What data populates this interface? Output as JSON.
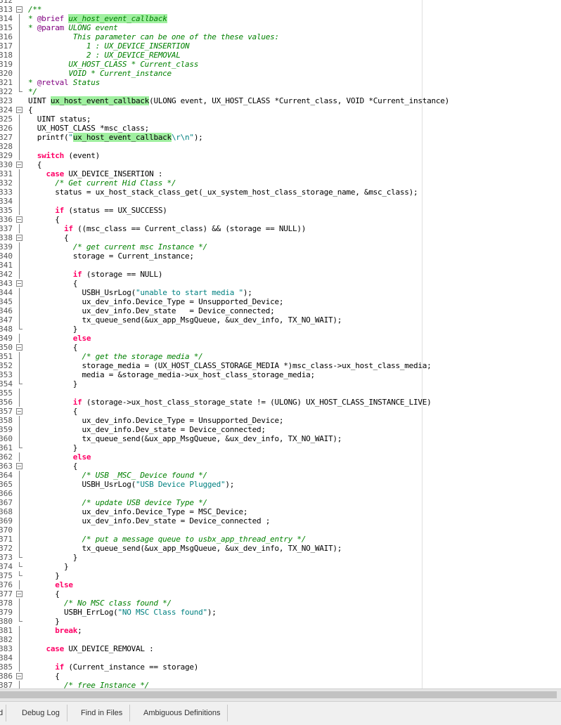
{
  "editor": {
    "lines": [
      {
        "n": "312",
        "fold": "none",
        "tokens": []
      },
      {
        "n": "313",
        "fold": "box",
        "tokens": [
          {
            "t": "/**",
            "c": "cm"
          }
        ]
      },
      {
        "n": "314",
        "fold": "line",
        "tokens": [
          {
            "t": "* ",
            "c": "cm"
          },
          {
            "t": "@brief",
            "c": "mg"
          },
          {
            "t": " ",
            "c": "cm"
          },
          {
            "t": "ux_host_event_callback",
            "c": "hlcm"
          }
        ]
      },
      {
        "n": "315",
        "fold": "line",
        "tokens": [
          {
            "t": "* ",
            "c": "cm"
          },
          {
            "t": "@param",
            "c": "mg"
          },
          {
            "t": " ULONG event",
            "c": "cm"
          }
        ]
      },
      {
        "n": "316",
        "fold": "line",
        "tokens": [
          {
            "t": "          This parameter can be one of the these values:",
            "c": "cm"
          }
        ]
      },
      {
        "n": "317",
        "fold": "line",
        "tokens": [
          {
            "t": "             1 : UX_DEVICE_INSERTION",
            "c": "cm"
          }
        ]
      },
      {
        "n": "318",
        "fold": "line",
        "tokens": [
          {
            "t": "             2 : UX_DEVICE_REMOVAL",
            "c": "cm"
          }
        ]
      },
      {
        "n": "319",
        "fold": "line",
        "tokens": [
          {
            "t": "         UX_HOST_CLASS * Current_class",
            "c": "cm"
          }
        ]
      },
      {
        "n": "320",
        "fold": "line",
        "tokens": [
          {
            "t": "         VOID * Current_instance",
            "c": "cm"
          }
        ]
      },
      {
        "n": "321",
        "fold": "line",
        "tokens": [
          {
            "t": "* ",
            "c": "cm"
          },
          {
            "t": "@retval",
            "c": "mg"
          },
          {
            "t": " Status",
            "c": "cm"
          }
        ]
      },
      {
        "n": "322",
        "fold": "end",
        "tokens": [
          {
            "t": "*/",
            "c": "cm"
          }
        ]
      },
      {
        "n": "323",
        "fold": "none",
        "tokens": [
          {
            "t": "UINT ",
            "c": "pl"
          },
          {
            "t": "ux_host_event_callback",
            "c": "hl"
          },
          {
            "t": "(ULONG event, UX_HOST_CLASS *Current_class, VOID *Current_instance)",
            "c": "pl"
          }
        ]
      },
      {
        "n": "324",
        "fold": "box",
        "tokens": [
          {
            "t": "{",
            "c": "pl"
          }
        ]
      },
      {
        "n": "325",
        "fold": "line",
        "tokens": [
          {
            "t": "  UINT status;",
            "c": "pl"
          }
        ]
      },
      {
        "n": "326",
        "fold": "line",
        "tokens": [
          {
            "t": "  UX_HOST_CLASS *msc_class;",
            "c": "pl"
          }
        ]
      },
      {
        "n": "327",
        "fold": "line",
        "tokens": [
          {
            "t": "  printf(",
            "c": "pl"
          },
          {
            "t": "\"",
            "c": "st"
          },
          {
            "t": "ux_host_event_callback",
            "c": "hl"
          },
          {
            "t": "\\r\\n\"",
            "c": "st"
          },
          {
            "t": ");",
            "c": "pl"
          }
        ]
      },
      {
        "n": "328",
        "fold": "line",
        "tokens": []
      },
      {
        "n": "329",
        "fold": "line",
        "tokens": [
          {
            "t": "  ",
            "c": "pl"
          },
          {
            "t": "switch",
            "c": "kw"
          },
          {
            "t": " (event)",
            "c": "pl"
          }
        ]
      },
      {
        "n": "330",
        "fold": "box",
        "tokens": [
          {
            "t": "  {",
            "c": "pl"
          }
        ]
      },
      {
        "n": "331",
        "fold": "line",
        "tokens": [
          {
            "t": "    ",
            "c": "pl"
          },
          {
            "t": "case",
            "c": "kw"
          },
          {
            "t": " UX_DEVICE_INSERTION :",
            "c": "pl"
          }
        ]
      },
      {
        "n": "332",
        "fold": "line",
        "tokens": [
          {
            "t": "      /* Get current Hid Class */",
            "c": "cm"
          }
        ]
      },
      {
        "n": "333",
        "fold": "line",
        "tokens": [
          {
            "t": "      status = ux_host_stack_class_get(_ux_system_host_class_storage_name, &msc_class);",
            "c": "pl"
          }
        ]
      },
      {
        "n": "334",
        "fold": "line",
        "tokens": []
      },
      {
        "n": "335",
        "fold": "line",
        "tokens": [
          {
            "t": "      ",
            "c": "pl"
          },
          {
            "t": "if",
            "c": "kw"
          },
          {
            "t": " (status == UX_SUCCESS)",
            "c": "pl"
          }
        ]
      },
      {
        "n": "336",
        "fold": "box",
        "tokens": [
          {
            "t": "      {",
            "c": "pl"
          }
        ]
      },
      {
        "n": "337",
        "fold": "line",
        "tokens": [
          {
            "t": "        ",
            "c": "pl"
          },
          {
            "t": "if",
            "c": "kw"
          },
          {
            "t": " ((msc_class == Current_class) && (storage == NULL))",
            "c": "pl"
          }
        ]
      },
      {
        "n": "338",
        "fold": "box",
        "tokens": [
          {
            "t": "        {",
            "c": "pl"
          }
        ]
      },
      {
        "n": "339",
        "fold": "line",
        "tokens": [
          {
            "t": "          /* get current msc Instance */",
            "c": "cm"
          }
        ]
      },
      {
        "n": "340",
        "fold": "line",
        "tokens": [
          {
            "t": "          storage = Current_instance;",
            "c": "pl"
          }
        ]
      },
      {
        "n": "341",
        "fold": "line",
        "tokens": []
      },
      {
        "n": "342",
        "fold": "line",
        "tokens": [
          {
            "t": "          ",
            "c": "pl"
          },
          {
            "t": "if",
            "c": "kw"
          },
          {
            "t": " (storage == NULL)",
            "c": "pl"
          }
        ]
      },
      {
        "n": "343",
        "fold": "box",
        "tokens": [
          {
            "t": "          {",
            "c": "pl"
          }
        ]
      },
      {
        "n": "344",
        "fold": "line",
        "tokens": [
          {
            "t": "            USBH_UsrLog(",
            "c": "pl"
          },
          {
            "t": "\"unable to start media \"",
            "c": "st"
          },
          {
            "t": ");",
            "c": "pl"
          }
        ]
      },
      {
        "n": "345",
        "fold": "line",
        "tokens": [
          {
            "t": "            ux_dev_info.Device_Type = Unsupported_Device;",
            "c": "pl"
          }
        ]
      },
      {
        "n": "346",
        "fold": "line",
        "tokens": [
          {
            "t": "            ux_dev_info.Dev_state   = Device_connected;",
            "c": "pl"
          }
        ]
      },
      {
        "n": "347",
        "fold": "line",
        "tokens": [
          {
            "t": "            tx_queue_send(&ux_app_MsgQueue, &ux_dev_info, TX_NO_WAIT);",
            "c": "pl"
          }
        ]
      },
      {
        "n": "348",
        "fold": "end",
        "tokens": [
          {
            "t": "          }",
            "c": "pl"
          }
        ]
      },
      {
        "n": "349",
        "fold": "line",
        "tokens": [
          {
            "t": "          ",
            "c": "pl"
          },
          {
            "t": "else",
            "c": "kw"
          }
        ]
      },
      {
        "n": "350",
        "fold": "box",
        "tokens": [
          {
            "t": "          {",
            "c": "pl"
          }
        ]
      },
      {
        "n": "351",
        "fold": "line",
        "tokens": [
          {
            "t": "            /* get the storage media */",
            "c": "cm"
          }
        ]
      },
      {
        "n": "352",
        "fold": "line",
        "tokens": [
          {
            "t": "            storage_media = (UX_HOST_CLASS_STORAGE_MEDIA *)msc_class->ux_host_class_media;",
            "c": "pl"
          }
        ]
      },
      {
        "n": "353",
        "fold": "line",
        "tokens": [
          {
            "t": "            media = &storage_media->ux_host_class_storage_media;",
            "c": "pl"
          }
        ]
      },
      {
        "n": "354",
        "fold": "end",
        "tokens": [
          {
            "t": "          }",
            "c": "pl"
          }
        ]
      },
      {
        "n": "355",
        "fold": "line",
        "tokens": []
      },
      {
        "n": "356",
        "fold": "line",
        "tokens": [
          {
            "t": "          ",
            "c": "pl"
          },
          {
            "t": "if",
            "c": "kw"
          },
          {
            "t": " (storage->ux_host_class_storage_state != (ULONG) UX_HOST_CLASS_INSTANCE_LIVE)",
            "c": "pl"
          }
        ]
      },
      {
        "n": "357",
        "fold": "box",
        "tokens": [
          {
            "t": "          {",
            "c": "pl"
          }
        ]
      },
      {
        "n": "358",
        "fold": "line",
        "tokens": [
          {
            "t": "            ux_dev_info.Device_Type = Unsupported_Device;",
            "c": "pl"
          }
        ]
      },
      {
        "n": "359",
        "fold": "line",
        "tokens": [
          {
            "t": "            ux_dev_info.Dev_state = Device_connected;",
            "c": "pl"
          }
        ]
      },
      {
        "n": "360",
        "fold": "line",
        "tokens": [
          {
            "t": "            tx_queue_send(&ux_app_MsgQueue, &ux_dev_info, TX_NO_WAIT);",
            "c": "pl"
          }
        ]
      },
      {
        "n": "361",
        "fold": "end",
        "tokens": [
          {
            "t": "          }",
            "c": "pl"
          }
        ]
      },
      {
        "n": "362",
        "fold": "line",
        "tokens": [
          {
            "t": "          ",
            "c": "pl"
          },
          {
            "t": "else",
            "c": "kw"
          }
        ]
      },
      {
        "n": "363",
        "fold": "box",
        "tokens": [
          {
            "t": "          {",
            "c": "pl"
          }
        ]
      },
      {
        "n": "364",
        "fold": "line",
        "tokens": [
          {
            "t": "            /* USB _MSC_ Device found */",
            "c": "cm"
          }
        ]
      },
      {
        "n": "365",
        "fold": "line",
        "tokens": [
          {
            "t": "            USBH_UsrLog(",
            "c": "pl"
          },
          {
            "t": "\"USB Device Plugged\"",
            "c": "st"
          },
          {
            "t": ");",
            "c": "pl"
          }
        ]
      },
      {
        "n": "366",
        "fold": "line",
        "tokens": []
      },
      {
        "n": "367",
        "fold": "line",
        "tokens": [
          {
            "t": "            /* update USB device Type */",
            "c": "cm"
          }
        ]
      },
      {
        "n": "368",
        "fold": "line",
        "tokens": [
          {
            "t": "            ux_dev_info.Device_Type = MSC_Device;",
            "c": "pl"
          }
        ]
      },
      {
        "n": "369",
        "fold": "line",
        "tokens": [
          {
            "t": "            ux_dev_info.Dev_state = Device_connected ;",
            "c": "pl"
          }
        ]
      },
      {
        "n": "370",
        "fold": "line",
        "tokens": []
      },
      {
        "n": "371",
        "fold": "line",
        "tokens": [
          {
            "t": "            /* put a message queue to usbx_app_thread_entry */",
            "c": "cm"
          }
        ]
      },
      {
        "n": "372",
        "fold": "line",
        "tokens": [
          {
            "t": "            tx_queue_send(&ux_app_MsgQueue, &ux_dev_info, TX_NO_WAIT);",
            "c": "pl"
          }
        ]
      },
      {
        "n": "373",
        "fold": "end",
        "tokens": [
          {
            "t": "          }",
            "c": "pl"
          }
        ]
      },
      {
        "n": "374",
        "fold": "end",
        "tokens": [
          {
            "t": "        }",
            "c": "pl"
          }
        ]
      },
      {
        "n": "375",
        "fold": "end",
        "tokens": [
          {
            "t": "      }",
            "c": "pl"
          }
        ]
      },
      {
        "n": "376",
        "fold": "line",
        "tokens": [
          {
            "t": "      ",
            "c": "pl"
          },
          {
            "t": "else",
            "c": "kw"
          }
        ]
      },
      {
        "n": "377",
        "fold": "box",
        "tokens": [
          {
            "t": "      {",
            "c": "pl"
          }
        ]
      },
      {
        "n": "378",
        "fold": "line",
        "tokens": [
          {
            "t": "        /* No MSC class found */",
            "c": "cm"
          }
        ]
      },
      {
        "n": "379",
        "fold": "line",
        "tokens": [
          {
            "t": "        USBH_ErrLog(",
            "c": "pl"
          },
          {
            "t": "\"NO MSC Class found\"",
            "c": "st"
          },
          {
            "t": ");",
            "c": "pl"
          }
        ]
      },
      {
        "n": "380",
        "fold": "end",
        "tokens": [
          {
            "t": "      }",
            "c": "pl"
          }
        ]
      },
      {
        "n": "381",
        "fold": "line",
        "tokens": [
          {
            "t": "      ",
            "c": "pl"
          },
          {
            "t": "break",
            "c": "kw"
          },
          {
            "t": ";",
            "c": "pl"
          }
        ]
      },
      {
        "n": "382",
        "fold": "line",
        "tokens": []
      },
      {
        "n": "383",
        "fold": "line",
        "tokens": [
          {
            "t": "    ",
            "c": "pl"
          },
          {
            "t": "case",
            "c": "kw"
          },
          {
            "t": " UX_DEVICE_REMOVAL :",
            "c": "pl"
          }
        ]
      },
      {
        "n": "384",
        "fold": "line",
        "tokens": []
      },
      {
        "n": "385",
        "fold": "line",
        "tokens": [
          {
            "t": "      ",
            "c": "pl"
          },
          {
            "t": "if",
            "c": "kw"
          },
          {
            "t": " (Current_instance == storage)",
            "c": "pl"
          }
        ]
      },
      {
        "n": "386",
        "fold": "box",
        "tokens": [
          {
            "t": "      {",
            "c": "pl"
          }
        ]
      },
      {
        "n": "387",
        "fold": "line",
        "tokens": [
          {
            "t": "        /* free Instance */",
            "c": "cm"
          }
        ]
      }
    ]
  },
  "bottom_tabs": {
    "partial": "d",
    "debug_log": "Debug Log",
    "find_in_files": "Find in Files",
    "ambiguous_definitions": "Ambiguous Definitions"
  }
}
